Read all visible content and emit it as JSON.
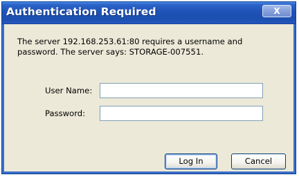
{
  "window": {
    "title": "Authentication Required",
    "close_glyph": "X"
  },
  "message": {
    "line1": "The server 192.168.253.61:80 requires a username and",
    "line2": "password. The server says: STORAGE-007551."
  },
  "form": {
    "username_label": "User Name:",
    "username_value": "",
    "password_label": "Password:",
    "password_value": ""
  },
  "buttons": {
    "login_label": "Log In",
    "cancel_label": "Cancel"
  },
  "colors": {
    "titlebar": "#1f52b6",
    "dialog_face": "#ece9d8",
    "input_border": "#7f9db9"
  }
}
